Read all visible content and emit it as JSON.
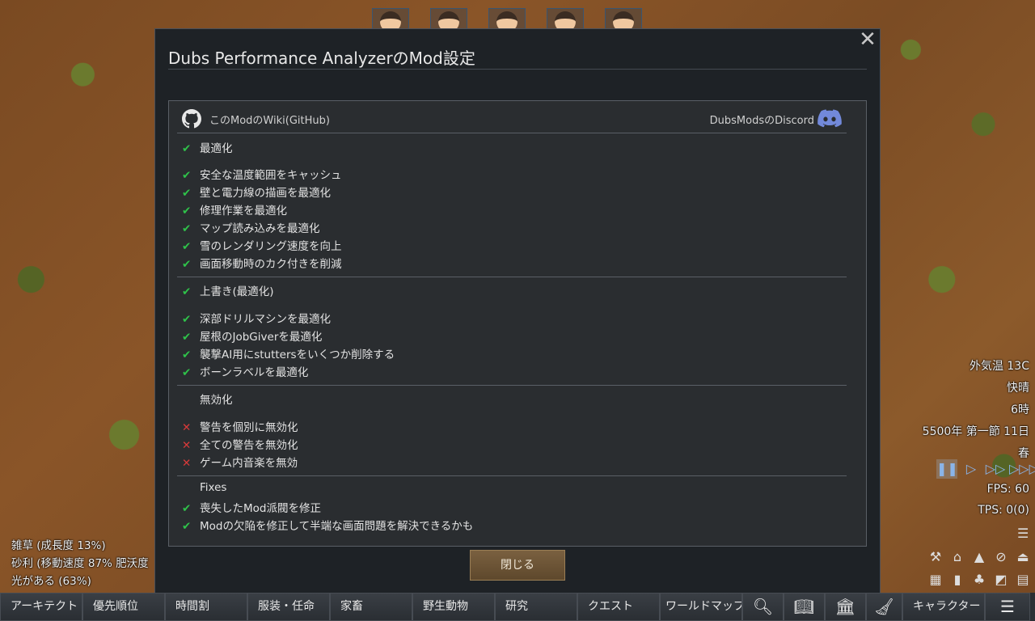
{
  "dialog": {
    "title": "Dubs Performance AnalyzerのMod設定",
    "close_label": "閉じる",
    "links": {
      "wiki": "このModのWiki(GitHub)",
      "discord": "DubsModsのDiscord"
    },
    "sections": [
      {
        "header": {
          "mark": "check",
          "text": "最適化"
        },
        "items": [
          {
            "mark": "check",
            "text": "安全な温度範囲をキャッシュ"
          },
          {
            "mark": "check",
            "text": "壁と電力線の描画を最適化"
          },
          {
            "mark": "check",
            "text": "修理作業を最適化"
          },
          {
            "mark": "check",
            "text": "マップ読み込みを最適化"
          },
          {
            "mark": "check",
            "text": "雪のレンダリング速度を向上"
          },
          {
            "mark": "check",
            "text": "画面移動時のカク付きを削減"
          }
        ]
      },
      {
        "header": {
          "mark": "check",
          "text": "上書き(最適化)"
        },
        "items": [
          {
            "mark": "check",
            "text": "深部ドリルマシンを最適化"
          },
          {
            "mark": "check",
            "text": "屋根のJobGiverを最適化"
          },
          {
            "mark": "check",
            "text": "襲撃AI用にstuttersをいくつか削除する"
          },
          {
            "mark": "check",
            "text": "ボーンラベルを最適化"
          }
        ]
      },
      {
        "header": {
          "mark": "none",
          "text": "無効化"
        },
        "items": [
          {
            "mark": "cross",
            "text": "警告を個別に無効化"
          },
          {
            "mark": "cross",
            "text": "全ての警告を無効化"
          },
          {
            "mark": "cross",
            "text": "ゲーム内音楽を無効"
          }
        ]
      },
      {
        "header": {
          "mark": "none",
          "text": "Fixes"
        },
        "items": [
          {
            "mark": "check",
            "text": "喪失したMod派閥を修正"
          },
          {
            "mark": "check",
            "text": "Modの欠陥を修正して半端な画面問題を解決できるかも"
          }
        ]
      }
    ]
  },
  "status": {
    "temperature": "外気温 13C",
    "weather": "快晴",
    "hour": "6時",
    "date": "5500年 第一節 11日",
    "season": "春",
    "fps": "FPS: 60",
    "tps": "TPS: 0(0)"
  },
  "terrain": {
    "line1": "雑草 (成長度  13%)",
    "line2": "砂利 (移動速度 87% 肥沃度",
    "line3": "光がある (63%)"
  },
  "bottombar": {
    "tabs": [
      "アーキテクト",
      "優先順位",
      "時間割",
      "服装・任命",
      "家畜",
      "野生動物",
      "研究",
      "クエスト",
      "ワールドマップ",
      "キャラクター"
    ]
  },
  "colors": {
    "check": "#2fc24a",
    "cross": "#d83a3a",
    "button": "#6b5236"
  }
}
